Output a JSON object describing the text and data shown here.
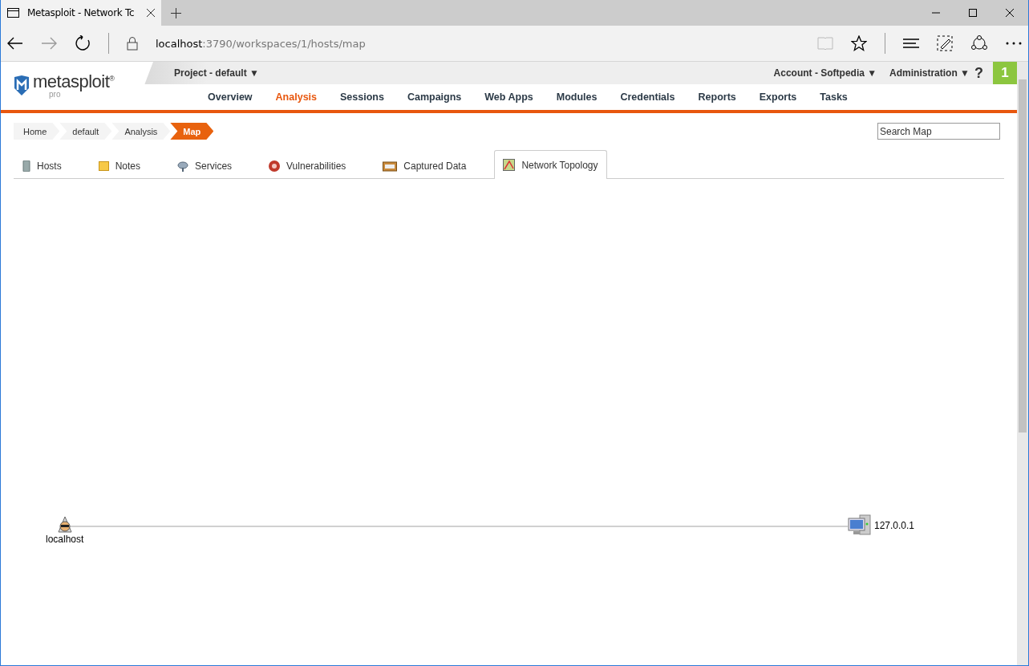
{
  "browser": {
    "tab_title": "Metasploit - Network Tc",
    "url_host": "localhost",
    "url_path": ":3790/workspaces/1/hosts/map"
  },
  "header": {
    "logo": {
      "name": "metasploit",
      "mark": "®",
      "edition": "pro"
    },
    "project": "Project - default ▼",
    "account": "Account - Softpedia ▼",
    "administration": "Administration ▼",
    "help": "?",
    "notifications": "1"
  },
  "nav": [
    {
      "label": "Overview",
      "selected": false
    },
    {
      "label": "Analysis",
      "selected": true
    },
    {
      "label": "Sessions",
      "selected": false
    },
    {
      "label": "Campaigns",
      "selected": false
    },
    {
      "label": "Web Apps",
      "selected": false
    },
    {
      "label": "Modules",
      "selected": false
    },
    {
      "label": "Credentials",
      "selected": false
    },
    {
      "label": "Reports",
      "selected": false
    },
    {
      "label": "Exports",
      "selected": false
    },
    {
      "label": "Tasks",
      "selected": false
    }
  ],
  "breadcrumbs": [
    {
      "label": "Home",
      "selected": false
    },
    {
      "label": "default",
      "selected": false
    },
    {
      "label": "Analysis",
      "selected": false
    },
    {
      "label": "Map",
      "selected": true
    }
  ],
  "search": {
    "placeholder": "Search Map"
  },
  "tabs": [
    {
      "label": "Hosts",
      "kind": "hosts",
      "selected": false
    },
    {
      "label": "Notes",
      "kind": "notes",
      "selected": false
    },
    {
      "label": "Services",
      "kind": "services",
      "selected": false
    },
    {
      "label": "Vulnerabilities",
      "kind": "vulns",
      "selected": false
    },
    {
      "label": "Captured Data",
      "kind": "loot",
      "selected": false
    },
    {
      "label": "Network Topology",
      "kind": "topology",
      "selected": true
    }
  ],
  "map": {
    "nodes": [
      {
        "label": "localhost",
        "kind": "attacker"
      },
      {
        "label": "127.0.0.1",
        "kind": "host"
      }
    ]
  }
}
